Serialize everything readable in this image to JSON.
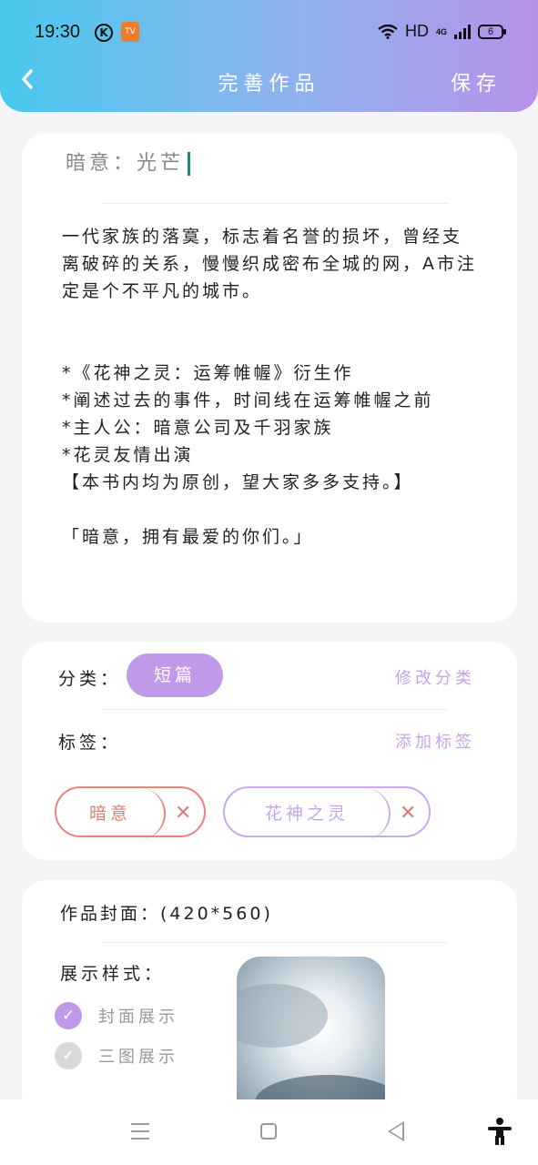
{
  "status_bar": {
    "time": "19:30",
    "k_icon": "K",
    "tv_icon": "TV",
    "hd": "HD",
    "network": "4G",
    "battery": "6"
  },
  "nav": {
    "title": "完善作品",
    "save_label": "保存"
  },
  "work": {
    "title": "暗意：光芒",
    "body": "一代家族的落寞，标志着名誉的损坏，曾经支离破碎的关系，慢慢织成密布全城的网，A市注定是个不平凡的城市。\n\n\n*《花神之灵：运筹帷幄》衍生作\n*阐述过去的事件，时间线在运筹帷幄之前\n*主人公：暗意公司及千羽家族\n*花灵友情出演\n【本书内均为原创，望大家多多支持。】\n\n「暗意，拥有最爱的你们。」"
  },
  "category": {
    "label": "分类：",
    "value": "短篇",
    "edit_label": "修改分类"
  },
  "tags": {
    "label": "标签：",
    "add_label": "添加标签",
    "items": [
      {
        "text": "暗意",
        "remove": "✕"
      },
      {
        "text": "花神之灵",
        "remove": "✕"
      }
    ]
  },
  "cover": {
    "label": "作品封面：(420*560)",
    "style_label": "展示样式：",
    "options": [
      {
        "text": "封面展示",
        "selected": true,
        "check": "✓"
      },
      {
        "text": "三图展示",
        "selected": false,
        "check": "✓"
      }
    ]
  },
  "colors": {
    "accent_purple": "#c09ae8",
    "tag_red": "#e07d78",
    "header_start": "#49c9ee",
    "header_end": "#b792ea"
  }
}
